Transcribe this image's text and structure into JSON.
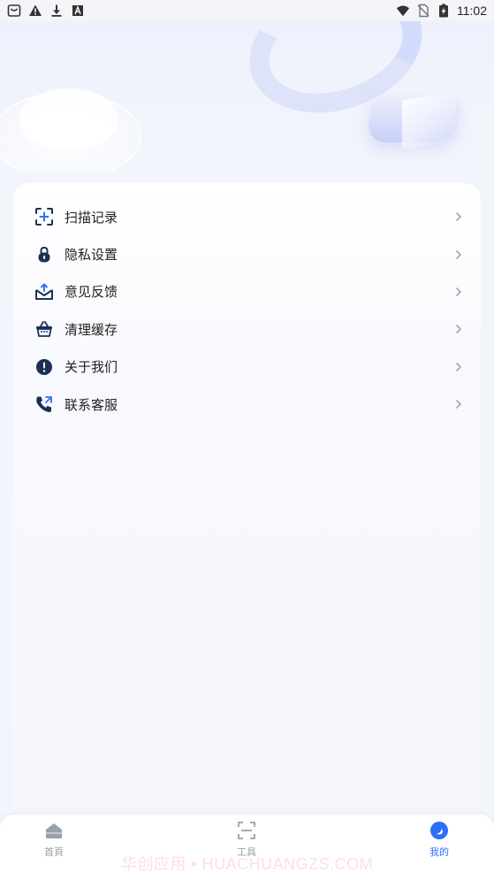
{
  "status_bar": {
    "time": "11:02",
    "left_icons": [
      "shopping-bag-icon",
      "warning-icon",
      "download-icon",
      "font-icon"
    ],
    "right_icons": [
      "wifi-icon",
      "no-sim-icon",
      "battery-charging-icon"
    ]
  },
  "menu": {
    "items": [
      {
        "label": "扫描记录",
        "icon": "scan-icon"
      },
      {
        "label": "隐私设置",
        "icon": "lock-icon"
      },
      {
        "label": "意见反馈",
        "icon": "feedback-mail-icon"
      },
      {
        "label": "清理缓存",
        "icon": "basket-icon"
      },
      {
        "label": "关于我们",
        "icon": "info-exclamation-icon"
      },
      {
        "label": "联系客服",
        "icon": "phone-icon"
      }
    ]
  },
  "bottom_nav": {
    "tabs": [
      {
        "label": "首頁",
        "icon": "home-icon",
        "active": false
      },
      {
        "label": "工具",
        "icon": "scan-frame-icon",
        "active": false
      },
      {
        "label": "我的",
        "icon": "profile-moon-icon",
        "active": true
      }
    ]
  },
  "watermark": "华创应用 • HUACHUANGZS.COM",
  "colors": {
    "accent": "#2f6ef6",
    "icon_dark": "#1e2f55",
    "background": "#f3f5fc",
    "nav_inactive": "#9aa0a8"
  }
}
